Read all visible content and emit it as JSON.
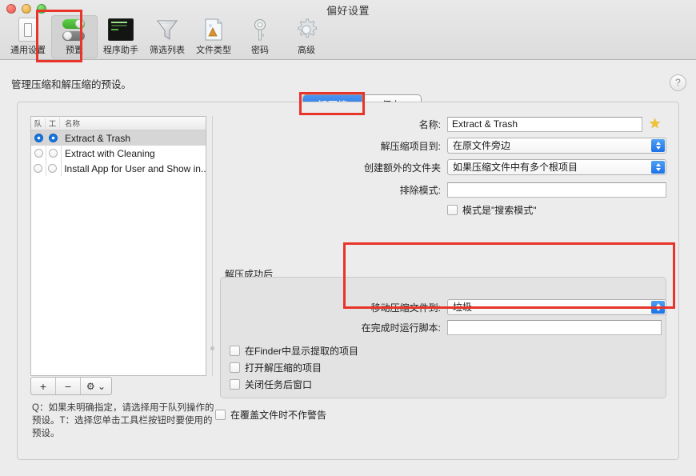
{
  "window": {
    "title": "偏好设置"
  },
  "toolbar": {
    "items": [
      {
        "label": "通用设置",
        "icon": "general-settings-icon",
        "selected": false
      },
      {
        "label": "预置",
        "icon": "presets-toggles-icon",
        "selected": true
      },
      {
        "label": "程序助手",
        "icon": "terminal-icon",
        "selected": false
      },
      {
        "label": "筛选列表",
        "icon": "funnel-icon",
        "selected": false
      },
      {
        "label": "文件类型",
        "icon": "file-type-icon",
        "selected": false
      },
      {
        "label": "密码",
        "icon": "key-icon",
        "selected": false
      },
      {
        "label": "高级",
        "icon": "gear-icon",
        "selected": false
      }
    ]
  },
  "page": {
    "intro": "管理压缩和解压缩的预设。",
    "help_icon": "?"
  },
  "tabs": [
    {
      "label": "解压缩",
      "active": true
    },
    {
      "label": "保存",
      "active": false
    }
  ],
  "list": {
    "headers": {
      "queue": "队",
      "toolbar": "工",
      "name": "名称"
    },
    "rows": [
      {
        "queue": true,
        "toolbar": true,
        "name": "Extract & Trash",
        "selected": true
      },
      {
        "queue": false,
        "toolbar": false,
        "name": "Extract with Cleaning",
        "selected": false
      },
      {
        "queue": false,
        "toolbar": false,
        "name": "Install App for User and Show in...",
        "selected": false
      }
    ],
    "buttons": [
      {
        "label": "+",
        "name": "add-preset-button"
      },
      {
        "label": "−",
        "name": "remove-preset-button"
      },
      {
        "label": "⚙ ⌄",
        "name": "preset-actions-button"
      }
    ],
    "help_text": "Q：如果未明确指定，请选择用于队列操作的预设。T：选择您单击工具栏按钮时要使用的预设。"
  },
  "form": {
    "name_label": "名称:",
    "name_value": "Extract & Trash",
    "favorite_icon": "star-icon",
    "extract_to_label": "解压缩项目到:",
    "extract_to_value": "在原文件旁边",
    "extra_folder_label": "创建额外的文件夹",
    "extra_folder_value": "如果压缩文件中有多个根项目",
    "exclude_label": "排除模式:",
    "exclude_value": "",
    "exclude_placeholder": "",
    "search_mode_checkbox": "模式是\"搜索模式\"",
    "group_title": "解压成功后",
    "move_archive_label": "移动压缩文件到:",
    "move_archive_value": "垃圾",
    "run_script_label": "在完成时运行脚本:",
    "run_script_value": "",
    "checkboxes": [
      "在Finder中显示提取的项目",
      "打开解压缩的项目",
      "关闭任务后窗口"
    ],
    "no_warn_checkbox": "在覆盖文件时不作警告"
  },
  "annotations": {
    "accent_red": "#e8342a",
    "boxes": [
      {
        "name": "presets-toolbar-highlight"
      },
      {
        "name": "extract-tab-highlight"
      },
      {
        "name": "after-extract-options-highlight"
      }
    ]
  }
}
